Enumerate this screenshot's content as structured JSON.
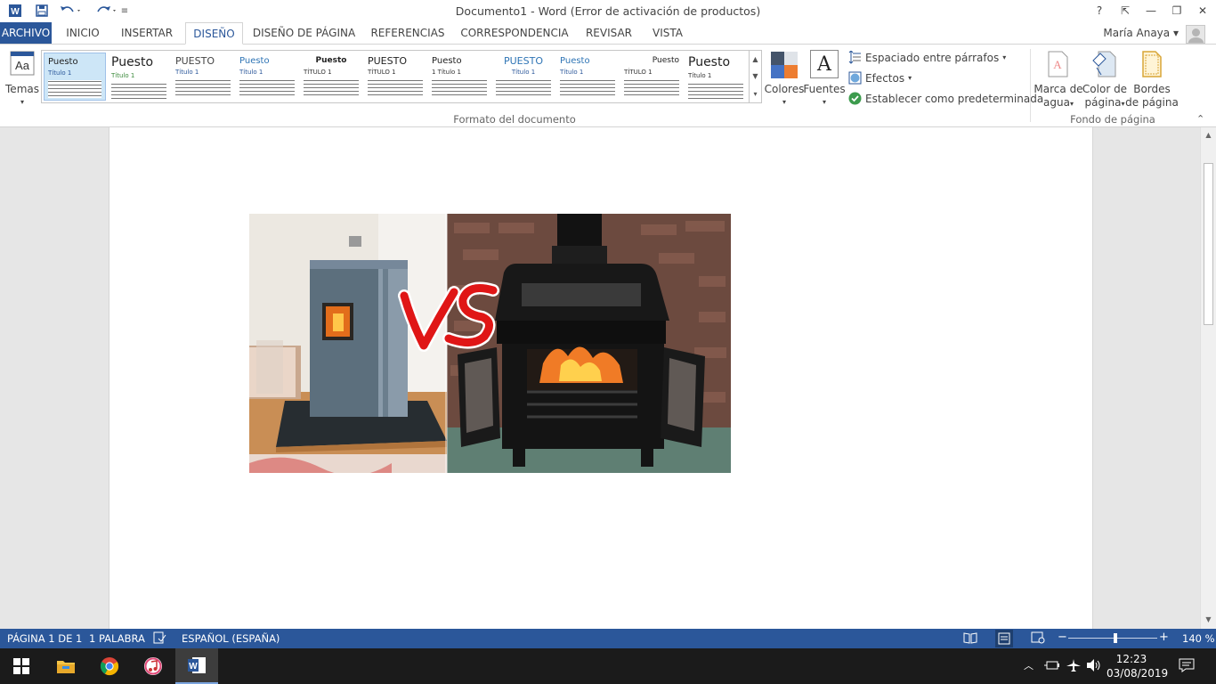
{
  "window": {
    "title": "Documento1 - Word (Error de activación de productos)",
    "controls": {
      "help": "?",
      "ribbon_display": "⇱",
      "minimize": "—",
      "restore": "❐",
      "close": "✕"
    }
  },
  "quick_access": {
    "app_icon": "W",
    "save_icon": "save-icon",
    "undo_icon": "undo-icon",
    "redo_icon": "redo-icon",
    "customize_icon": "customize-icon"
  },
  "tabs": [
    {
      "label": "ARCHIVO"
    },
    {
      "label": "INICIO"
    },
    {
      "label": "INSERTAR"
    },
    {
      "label": "DISEÑO"
    },
    {
      "label": "DISEÑO DE PÁGINA"
    },
    {
      "label": "REFERENCIAS"
    },
    {
      "label": "CORRESPONDENCIA"
    },
    {
      "label": "REVISAR"
    },
    {
      "label": "VISTA"
    }
  ],
  "user": {
    "name": "María Anaya",
    "dropdown": "▾"
  },
  "ribbon": {
    "temas": {
      "label": "Temas",
      "icon_text": "Aa"
    },
    "gallery_styles": [
      {
        "title": "Puesto",
        "heading": "Título 1"
      },
      {
        "title": "Puesto",
        "heading": "Título 1"
      },
      {
        "title": "PUESTO",
        "heading": "Título 1"
      },
      {
        "title": "Puesto",
        "heading": "Título 1"
      },
      {
        "title": "Puesto",
        "heading": "TÍTULO 1"
      },
      {
        "title": "PUESTO",
        "heading": "TÍTULO 1"
      },
      {
        "title": "Puesto",
        "heading": "1 Título 1"
      },
      {
        "title": "PUESTO",
        "heading": "Título 1"
      },
      {
        "title": "Puesto",
        "heading": "Título 1"
      },
      {
        "title": "Puesto",
        "heading": "TÍTULO 1"
      },
      {
        "title": "Puesto",
        "heading": "Título 1"
      }
    ],
    "colores": {
      "label": "Colores"
    },
    "fuentes": {
      "label": "Fuentes",
      "icon_text": "A"
    },
    "espaciado": {
      "label": "Espaciado entre párrafos"
    },
    "efectos": {
      "label": "Efectos"
    },
    "predeterminada": {
      "label": "Establecer como predeterminada"
    },
    "group_formato": "Formato del documento",
    "marca_agua": {
      "line1": "Marca de",
      "line2": "agua"
    },
    "color_pagina": {
      "line1": "Color de",
      "line2": "página"
    },
    "bordes": {
      "line1": "Bordes",
      "line2": "de página"
    },
    "group_fondo": "Fondo de página",
    "collapse": "⌃"
  },
  "document": {
    "vs_text": "VS"
  },
  "status": {
    "page": "PÁGINA 1 DE 1",
    "words": "1 PALABRA",
    "language": "ESPAÑOL (ESPAÑA)",
    "zoom": "140 %",
    "zoom_minus": "−",
    "zoom_plus": "+"
  },
  "taskbar": {
    "time": "12:23",
    "date": "03/08/2019",
    "word_label": "W"
  },
  "colors": {
    "accent": "#2b579a",
    "taskbar": "#1b1b1b"
  }
}
